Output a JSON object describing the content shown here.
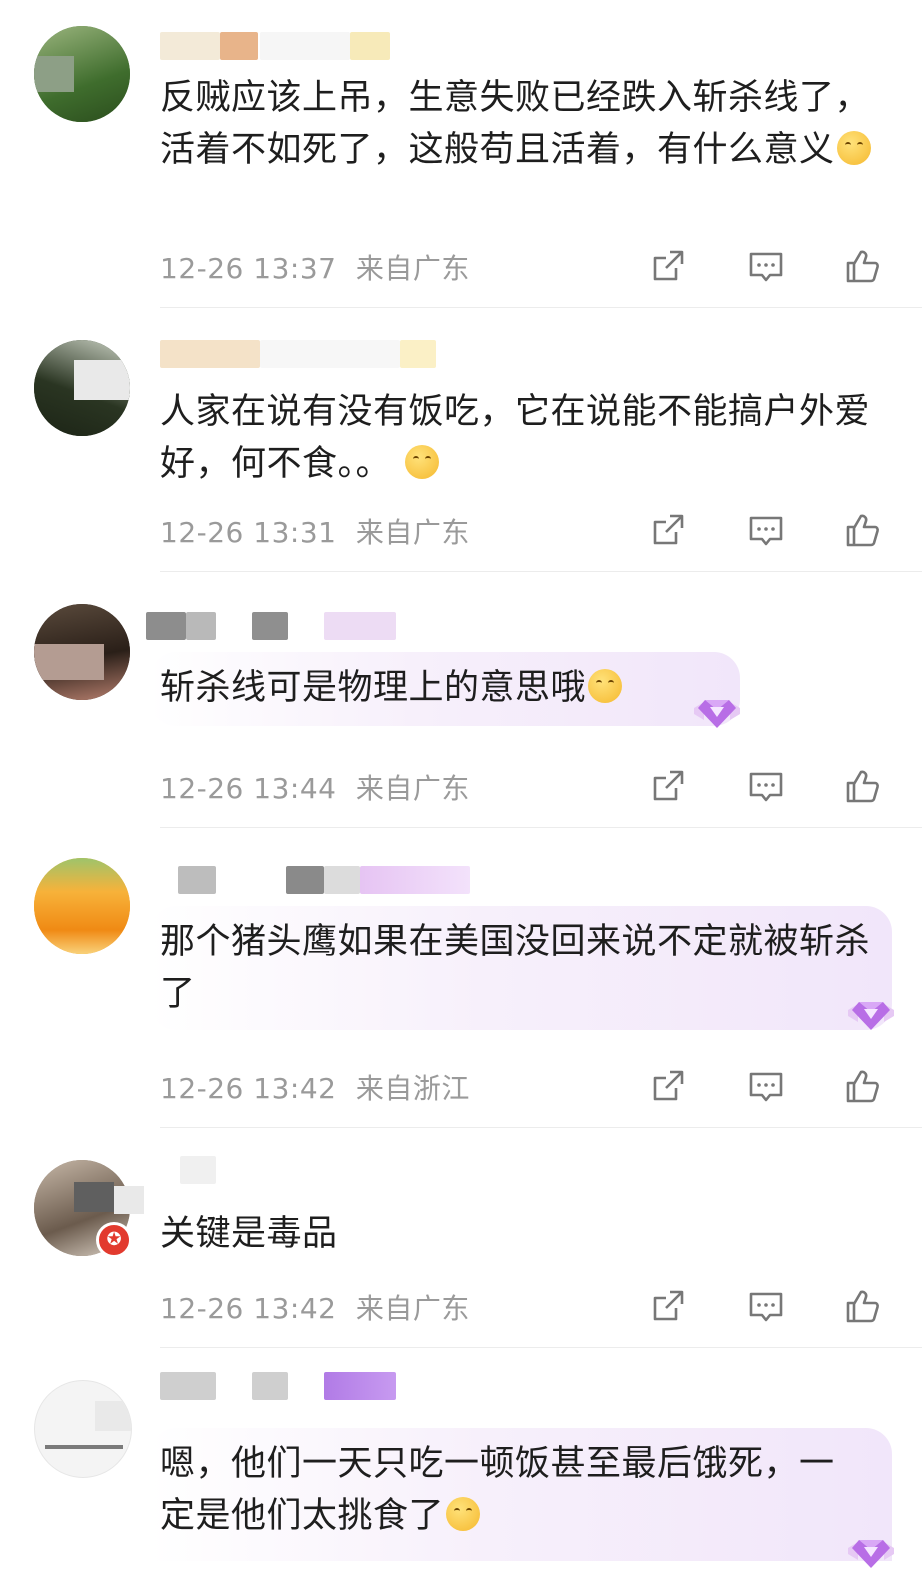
{
  "comments": [
    {
      "text": "反贼应该上吊，生意失败已经跌入斩杀线了，活着不如死了，这般苟且活着，有什么意义",
      "time": "12-26 13:37",
      "location": "来自广东",
      "emoji": "grin-emoji"
    },
    {
      "text": "人家在说有没有饭吃，它在说能不能搞户外爱好，何不食。。",
      "time": "12-26 13:31",
      "location": "来自广东",
      "emoji": "laugh-cry-emoji"
    },
    {
      "text": "斩杀线可是物理上的意思哦",
      "time": "12-26 13:44",
      "location": "来自广东",
      "emoji": "yum-emoji",
      "badge": "diamond-badge"
    },
    {
      "text": "那个猪头鹰如果在美国没回来说不定就被斩杀了",
      "time": "12-26 13:42",
      "location": "来自浙江",
      "badge": "diamond-badge"
    },
    {
      "text": "关键是毒品",
      "time": "12-26 13:42",
      "location": "来自广东"
    },
    {
      "text": "嗯，他们一天只吃一顿饭甚至最后饿死，一定是他们太挑食了",
      "emoji": "smirk-emoji",
      "badge": "diamond-badge"
    }
  ],
  "actions": {
    "share_icon": "share-icon",
    "comment_icon": "comment-icon",
    "like_icon": "thumbs-up-icon"
  },
  "colors": {
    "meta": "#9a9a9a",
    "text": "#1e1e1e",
    "bubble": "#f1e6fa"
  }
}
